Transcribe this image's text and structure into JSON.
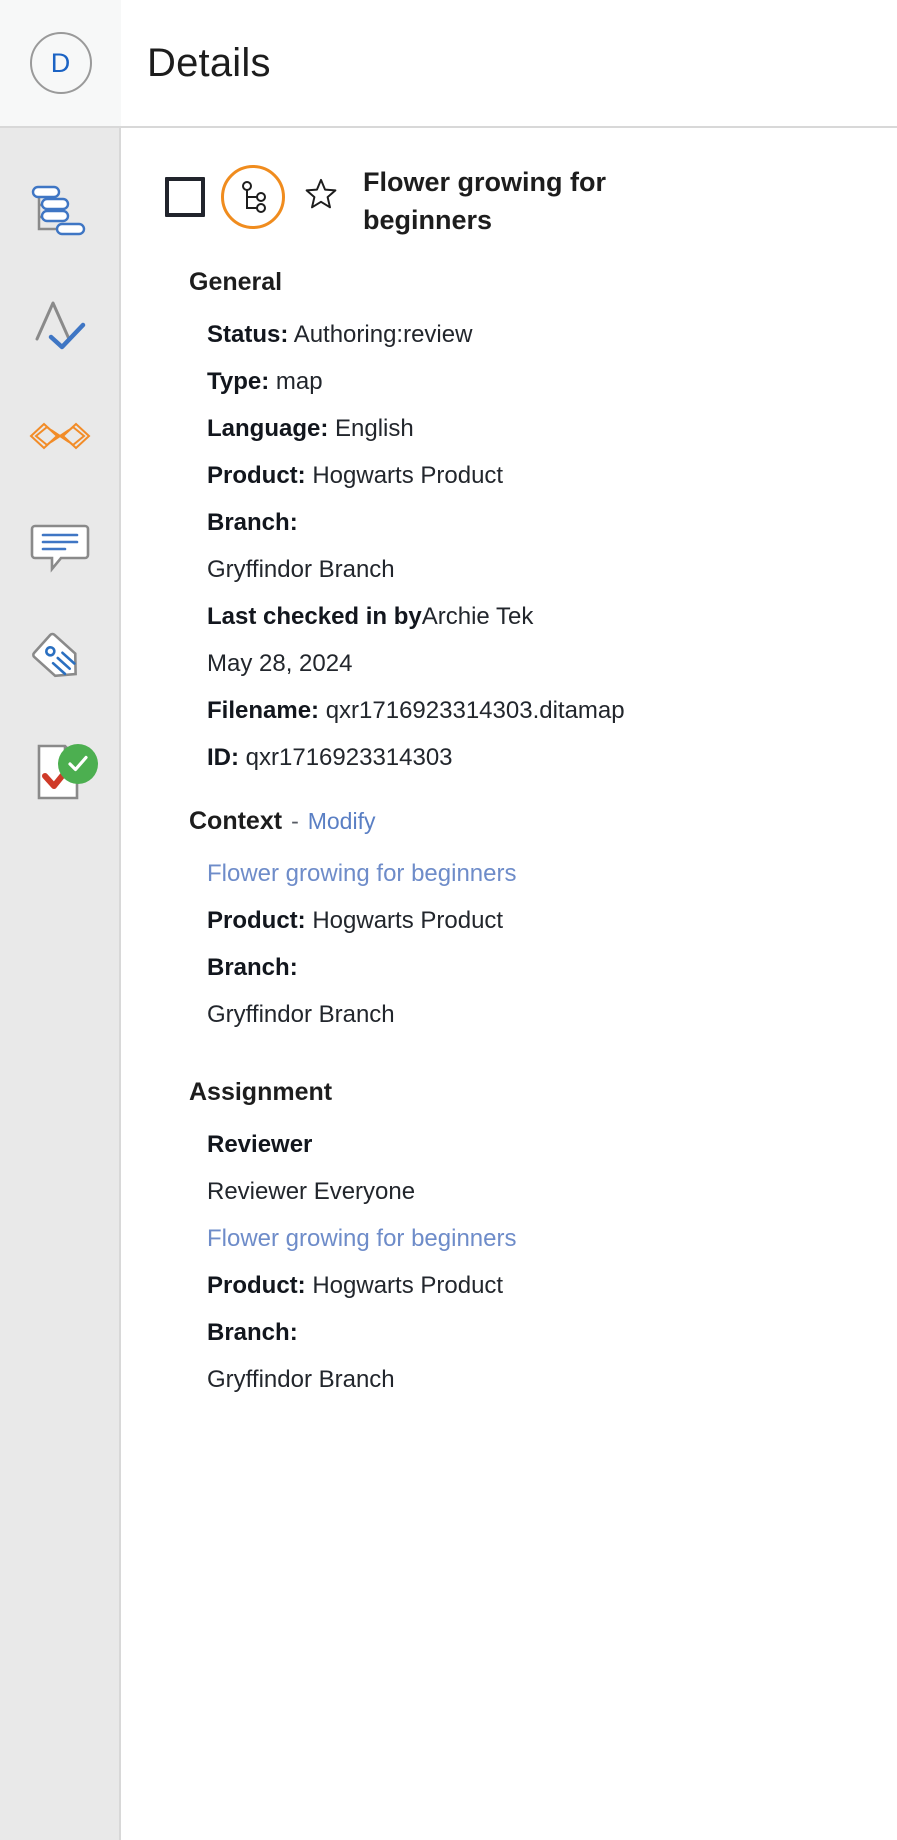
{
  "header": {
    "avatar_initial": "D",
    "title": "Details"
  },
  "sidebar": {
    "items": [
      {
        "icon": "hierarchy-tree-icon",
        "name": "map-structure"
      },
      {
        "icon": "spellcheck-icon",
        "name": "spellcheck"
      },
      {
        "icon": "link-chain-icon",
        "name": "links"
      },
      {
        "icon": "comment-bubble-icon",
        "name": "comments"
      },
      {
        "icon": "tag-icon",
        "name": "metadata-tags"
      },
      {
        "icon": "document-check-icon",
        "name": "review-status"
      }
    ]
  },
  "document": {
    "title": "Flower growing for beginners",
    "type_icon": "map-tree-icon",
    "favorite_icon": "star-outline-icon",
    "checkbox_checked": false
  },
  "general": {
    "heading": "General",
    "status_label": "Status:",
    "status_value": "Authoring:review",
    "type_label": "Type:",
    "type_value": "map",
    "language_label": "Language:",
    "language_value": "English",
    "product_label": "Product:",
    "product_value": "Hogwarts Product",
    "branch_label": "Branch:",
    "branch_value": "Gryffindor Branch",
    "last_checked_label": "Last checked in by",
    "last_checked_value": "Archie Tek",
    "last_checked_date": "May 28, 2024",
    "filename_label": "Filename:",
    "filename_value": "qxr1716923314303.ditamap",
    "id_label": "ID:",
    "id_value": "qxr1716923314303"
  },
  "context": {
    "heading": "Context",
    "dash": "-",
    "modify_label": "Modify",
    "link_title": "Flower growing for beginners",
    "product_label": "Product:",
    "product_value": "Hogwarts Product",
    "branch_label": "Branch:",
    "branch_value": "Gryffindor Branch"
  },
  "assignment": {
    "heading": "Assignment",
    "role_label": "Reviewer",
    "role_value": "Reviewer Everyone",
    "link_title": "Flower growing for beginners",
    "product_label": "Product:",
    "product_value": "Hogwarts Product",
    "branch_label": "Branch:",
    "branch_value": "Gryffindor Branch"
  },
  "colors": {
    "accent_orange": "#f08c1e",
    "link_blue": "#6e8cc9",
    "avatar_blue": "#1b63c4",
    "badge_green": "#4caf50",
    "check_red": "#cf3a28"
  }
}
